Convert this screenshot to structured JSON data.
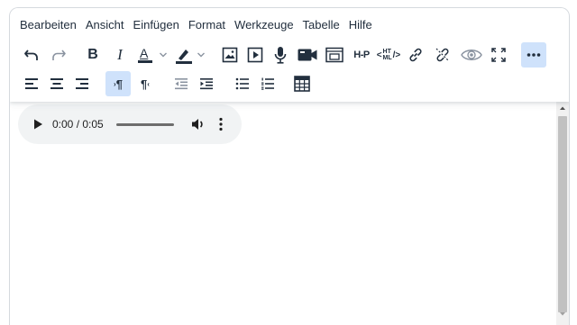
{
  "menubar": {
    "items": [
      {
        "label": "Bearbeiten"
      },
      {
        "label": "Ansicht"
      },
      {
        "label": "Einfügen"
      },
      {
        "label": "Format"
      },
      {
        "label": "Werkzeuge"
      },
      {
        "label": "Tabelle"
      },
      {
        "label": "Hilfe"
      }
    ]
  },
  "toolbar": {
    "row1": [
      {
        "icon": "undo-icon"
      },
      {
        "icon": "redo-icon"
      },
      {
        "icon": "bold-icon",
        "glyph": "B"
      },
      {
        "icon": "italic-icon",
        "glyph": "I"
      },
      {
        "icon": "text-color-icon",
        "glyph": "A"
      },
      {
        "icon": "highlight-color-icon"
      },
      {
        "icon": "image-icon"
      },
      {
        "icon": "media-icon"
      },
      {
        "icon": "microphone-icon"
      },
      {
        "icon": "video-camera-icon"
      },
      {
        "icon": "embed-icon"
      },
      {
        "icon": "h5p-icon",
        "glyph": "H-P"
      },
      {
        "icon": "html-code-icon",
        "glyph_top": "HT",
        "glyph_bottom": "ML"
      },
      {
        "icon": "link-icon"
      },
      {
        "icon": "unlink-icon"
      },
      {
        "icon": "preview-eye-icon"
      },
      {
        "icon": "fullscreen-icon"
      },
      {
        "icon": "more-icon"
      }
    ],
    "row2": [
      {
        "icon": "align-left-icon"
      },
      {
        "icon": "align-center-icon"
      },
      {
        "icon": "align-right-icon"
      },
      {
        "icon": "ltr-paragraph-icon",
        "glyph": "¶",
        "active": true
      },
      {
        "icon": "rtl-paragraph-icon",
        "glyph": "¶"
      },
      {
        "icon": "outdent-icon"
      },
      {
        "icon": "indent-icon"
      },
      {
        "icon": "bullet-list-icon"
      },
      {
        "icon": "numbered-list-icon"
      },
      {
        "icon": "table-icon"
      }
    ]
  },
  "colors": {
    "text_color_swatch": "#222f3e",
    "highlight_swatch": "#222f3e",
    "active_button": "#cfe2fb",
    "icon": "#222f3e"
  },
  "audio_player": {
    "time": "0:00 / 0:05",
    "progress": 0
  }
}
